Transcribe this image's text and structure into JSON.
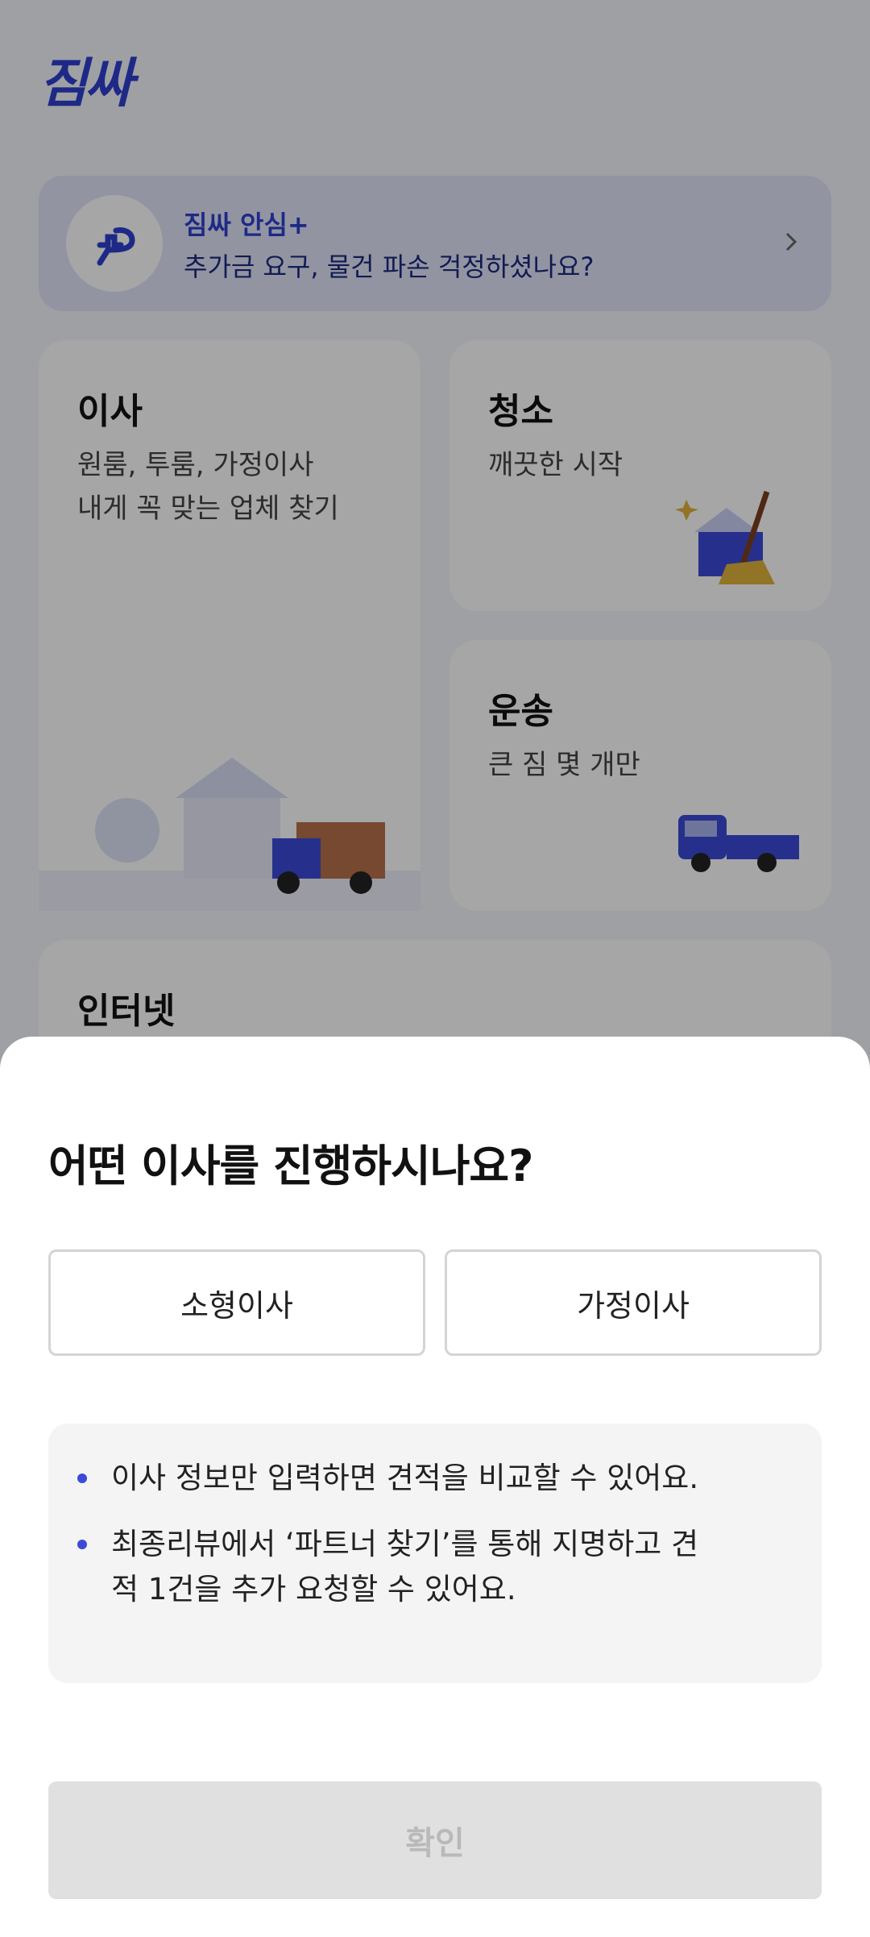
{
  "app": {
    "logo_text": "짐싸",
    "promo": {
      "title": "짐싸 안심+",
      "subtitle": "추가금 요구, 물건 파손 걱정하셨나요?"
    },
    "services": [
      {
        "title": "이사",
        "desc": "원룸, 투룸, 가정이사\n내게 꼭 맞는 업체 찾기"
      },
      {
        "title": "청소",
        "desc": "깨끗한 시작"
      },
      {
        "title": "운송",
        "desc": "큰 짐 몇 개만"
      },
      {
        "title": "인터넷",
        "desc": ""
      }
    ]
  },
  "sheet": {
    "title": "어떤 이사를 진행하시나요?",
    "options": [
      "소형이사",
      "가정이사"
    ],
    "info": [
      "이사 정보만 입력하면 견적을 비교할 수 있어요.",
      "최종리뷰에서 ‘파트너 찾기’를 통해 지명하고 견적 1건을 추가 요청할 수 있어요."
    ],
    "confirm_label": "확인"
  },
  "colors": {
    "brand": "#2f3fd0",
    "bullet": "#3b4bd8",
    "disabled_button": "#e0e0e0"
  }
}
